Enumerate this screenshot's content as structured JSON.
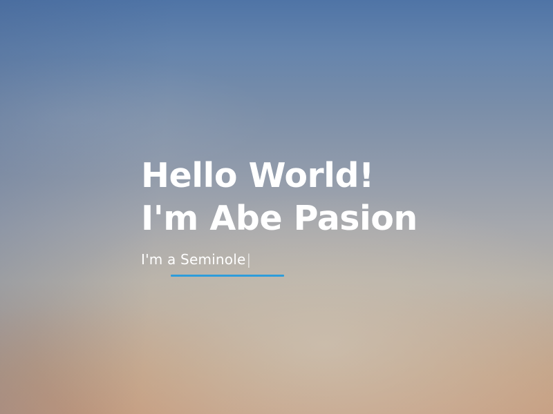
{
  "hero": {
    "headline_line1": "Hello World!",
    "headline_line2": "I'm Abe Pasion",
    "tagline": "I'm a Seminole",
    "cursor": "|",
    "underline_color": "#2d9cdb"
  }
}
